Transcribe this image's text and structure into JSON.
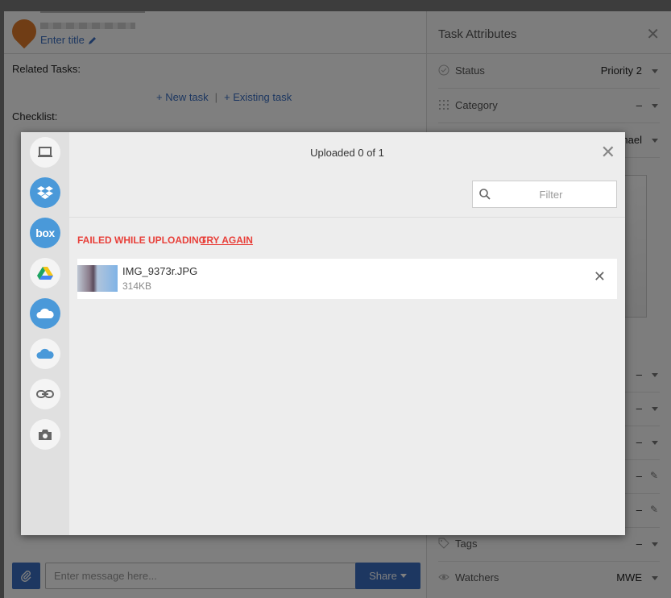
{
  "task": {
    "enter_title": "Enter title",
    "related_tasks_label": "Related Tasks:",
    "new_task_link": "+ New task",
    "separator": "|",
    "existing_task_link": "+ Existing task",
    "checklist_label": "Checklist:"
  },
  "composer": {
    "message_placeholder": "Enter message here...",
    "share_label": "Share"
  },
  "attributes": {
    "title": "Task Attributes",
    "close": "✕",
    "rows": [
      {
        "name": "Status",
        "value": "Priority 2",
        "icon": "check-circle-icon"
      },
      {
        "name": "Category",
        "value": "–",
        "icon": "grid-icon"
      },
      {
        "name": "",
        "value": "hael",
        "icon": ""
      },
      {
        "name": "",
        "value": "–",
        "icon": ""
      },
      {
        "name": "",
        "value": "–",
        "icon": ""
      },
      {
        "name": "",
        "value": "–",
        "icon": ""
      },
      {
        "name": "",
        "value": "–",
        "icon": ""
      },
      {
        "name": "",
        "value": "–",
        "icon": ""
      },
      {
        "name": "Tags",
        "value": "–",
        "icon": "tag-icon"
      },
      {
        "name": "Watchers",
        "value": "MWE",
        "icon": "eye-icon"
      }
    ]
  },
  "upload": {
    "title": "Uploaded 0 of 1",
    "close": "✕",
    "filter_placeholder": "Filter",
    "failed_text": "FAILED WHILE UPLOADING",
    "try_again": "TRY AGAIN",
    "file": {
      "name": "IMG_9373r.JPG",
      "size": "314KB"
    },
    "remove": "✕",
    "sources": [
      {
        "icon": "computer-icon"
      },
      {
        "icon": "dropbox-icon"
      },
      {
        "icon": "box-icon",
        "label": "box"
      },
      {
        "icon": "google-drive-icon"
      },
      {
        "icon": "onedrive-icon"
      },
      {
        "icon": "onedrive-business-icon"
      },
      {
        "icon": "link-icon"
      },
      {
        "icon": "camera-icon"
      }
    ]
  },
  "colors": {
    "accent": "#3a6fc2",
    "error": "#e8403a",
    "source_blue": "#4a99d9",
    "pin": "#e07b2b"
  }
}
